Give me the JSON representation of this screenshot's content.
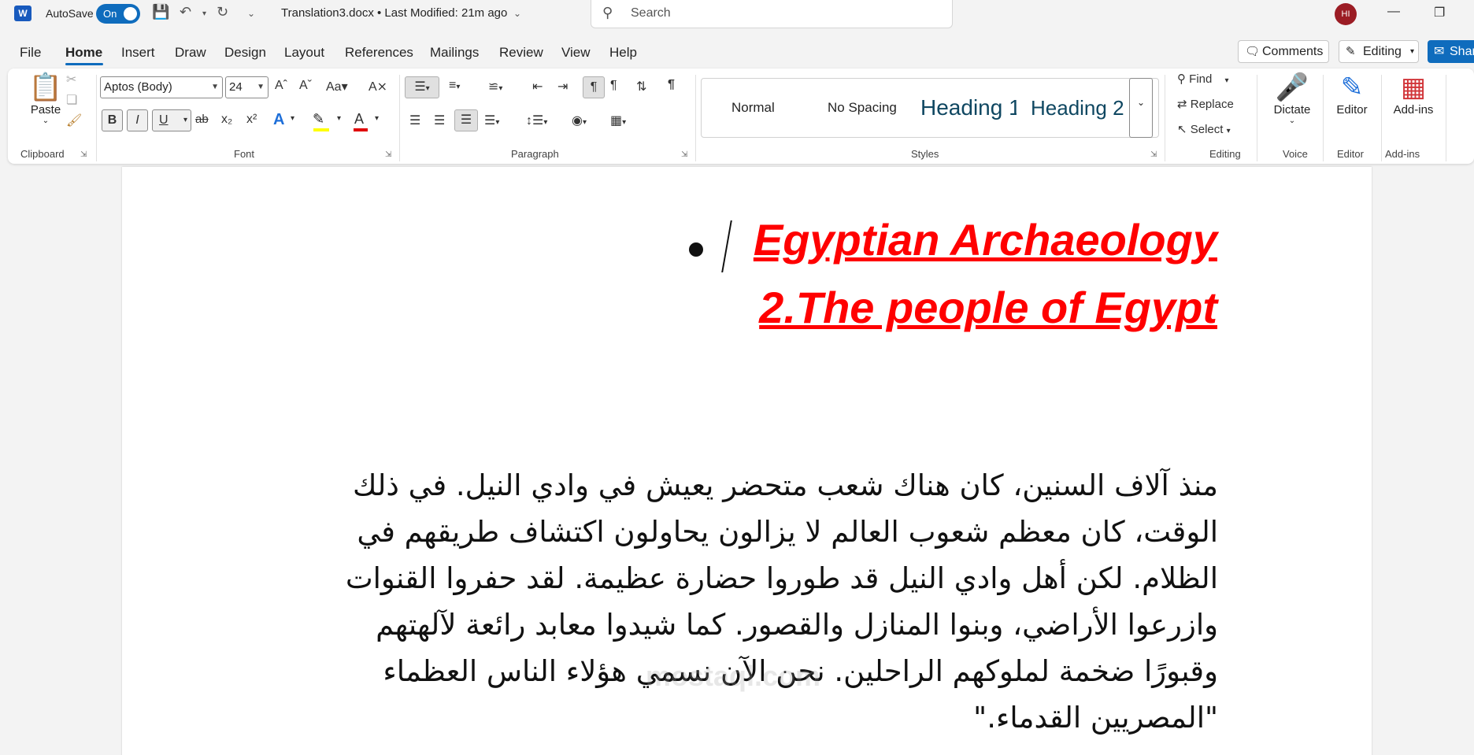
{
  "titlebar": {
    "app_logo": "W",
    "autosave_label": "AutoSave",
    "autosave_state": "On",
    "doc_title": "Translation3.docx  •  Last Modified: 21m ago",
    "search_placeholder": "Search",
    "avatar_initials": "HI"
  },
  "menu": {
    "items": [
      "File",
      "Home",
      "Insert",
      "Draw",
      "Design",
      "Layout",
      "References",
      "Mailings",
      "Review",
      "View",
      "Help"
    ],
    "comments_label": "Comments",
    "editing_label": "Editing",
    "share_label": "Shar"
  },
  "ribbon": {
    "groups": [
      "Clipboard",
      "Font",
      "Paragraph",
      "Styles",
      "Editing",
      "Voice",
      "Editor",
      "Add-ins"
    ],
    "paste_label": "Paste",
    "font_name": "Aptos (Body)",
    "font_size": "24",
    "bold": "B",
    "italic": "I",
    "underline": "U",
    "styles": [
      "Normal",
      "No Spacing",
      "Heading 1",
      "Heading 2"
    ],
    "find_label": "Find",
    "replace_label": "Replace",
    "select_label": "Select",
    "dictate_label": "Dictate",
    "editor_label": "Editor",
    "addins_label": "Add-ins"
  },
  "document": {
    "heading_line1": "Egyptian Archaeology",
    "heading_line2": "2.The people of Egypt",
    "paragraph": "منذ آلاف السنين، كان هناك شعب متحضر يعيش في وادي النيل. في ذلك الوقت، كان معظم شعوب العالم لا يزالون يحاولون اكتشاف طريقهم في الظلام. لكن أهل وادي النيل قد طوروا حضارة عظيمة. لقد حفروا القنوات وازرعوا الأراضي، وبنوا المنازل والقصور. كما شيدوا معابد رائعة لآلهتهم وقبورًا ضخمة لملوكهم الراحلين. نحن الآن نسمي هؤلاء الناس العظماء \"المصريين القدماء.\"",
    "watermark": "mostaql.com"
  },
  "colors": {
    "accent": "#0f6cbd",
    "heading": "#ff0000",
    "avatar": "#9b1c24"
  }
}
